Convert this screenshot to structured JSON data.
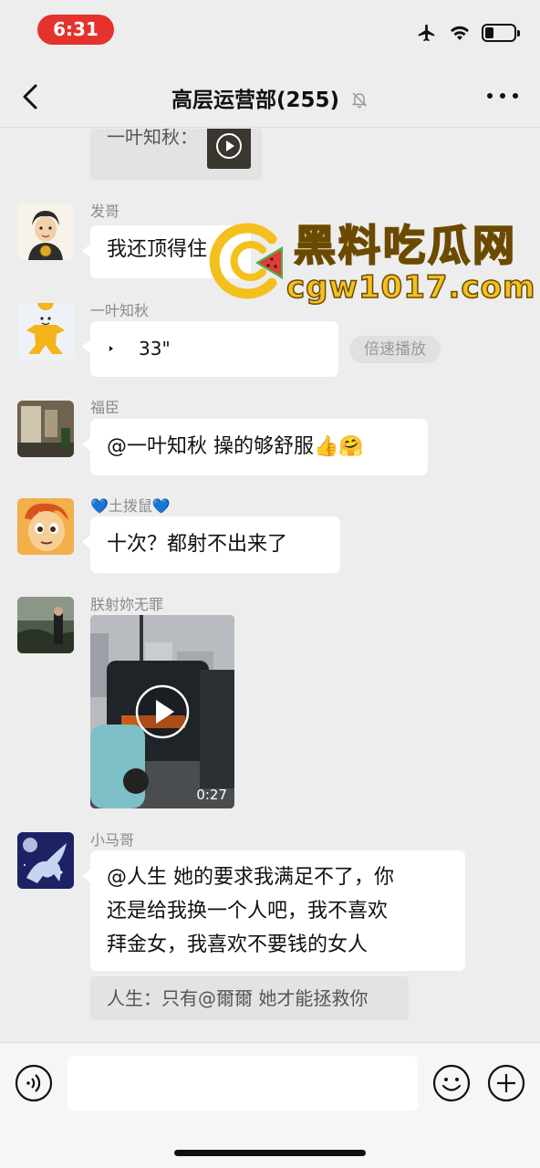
{
  "status_bar": {
    "time": "6:31"
  },
  "header": {
    "title": "高层运营部(255)"
  },
  "messages": [
    {
      "quote_text": "一叶知秋："
    },
    {
      "sender": "发哥",
      "text": "我还顶得住"
    },
    {
      "sender": "一叶知秋",
      "voice_duration": "33\"",
      "speed_label": "倍速播放"
    },
    {
      "sender": "福臣",
      "text": "@一叶知秋 操的够舒服👍🤗"
    },
    {
      "sender": "💙土拨鼠💙",
      "text": "十次？都射不出来了"
    },
    {
      "sender": "朕射妳无罪",
      "video_duration": "0:27"
    },
    {
      "sender": "小马哥",
      "text_lines": [
        "@人生 她的要求我满足不了，你",
        "还是给我换一个人吧，我不喜欢",
        "拜金女，我喜欢不要钱的女人"
      ],
      "quote_text": "人生：只有@爾爾 她才能拯救你"
    }
  ],
  "watermark": {
    "title": "黑料吃瓜网",
    "url": "cgw1017.com"
  },
  "input": {
    "placeholder": ""
  },
  "icons": {
    "back": "chevron-left-icon",
    "mute": "bell-slash-icon",
    "more": "more-icon",
    "voice": "voice-icon",
    "emoji": "emoji-icon",
    "add": "plus-icon"
  },
  "colors": {
    "background": "#ededed",
    "bubble": "#ffffff",
    "time_pill": "#e5322d",
    "watermark": "#f4c01e"
  }
}
